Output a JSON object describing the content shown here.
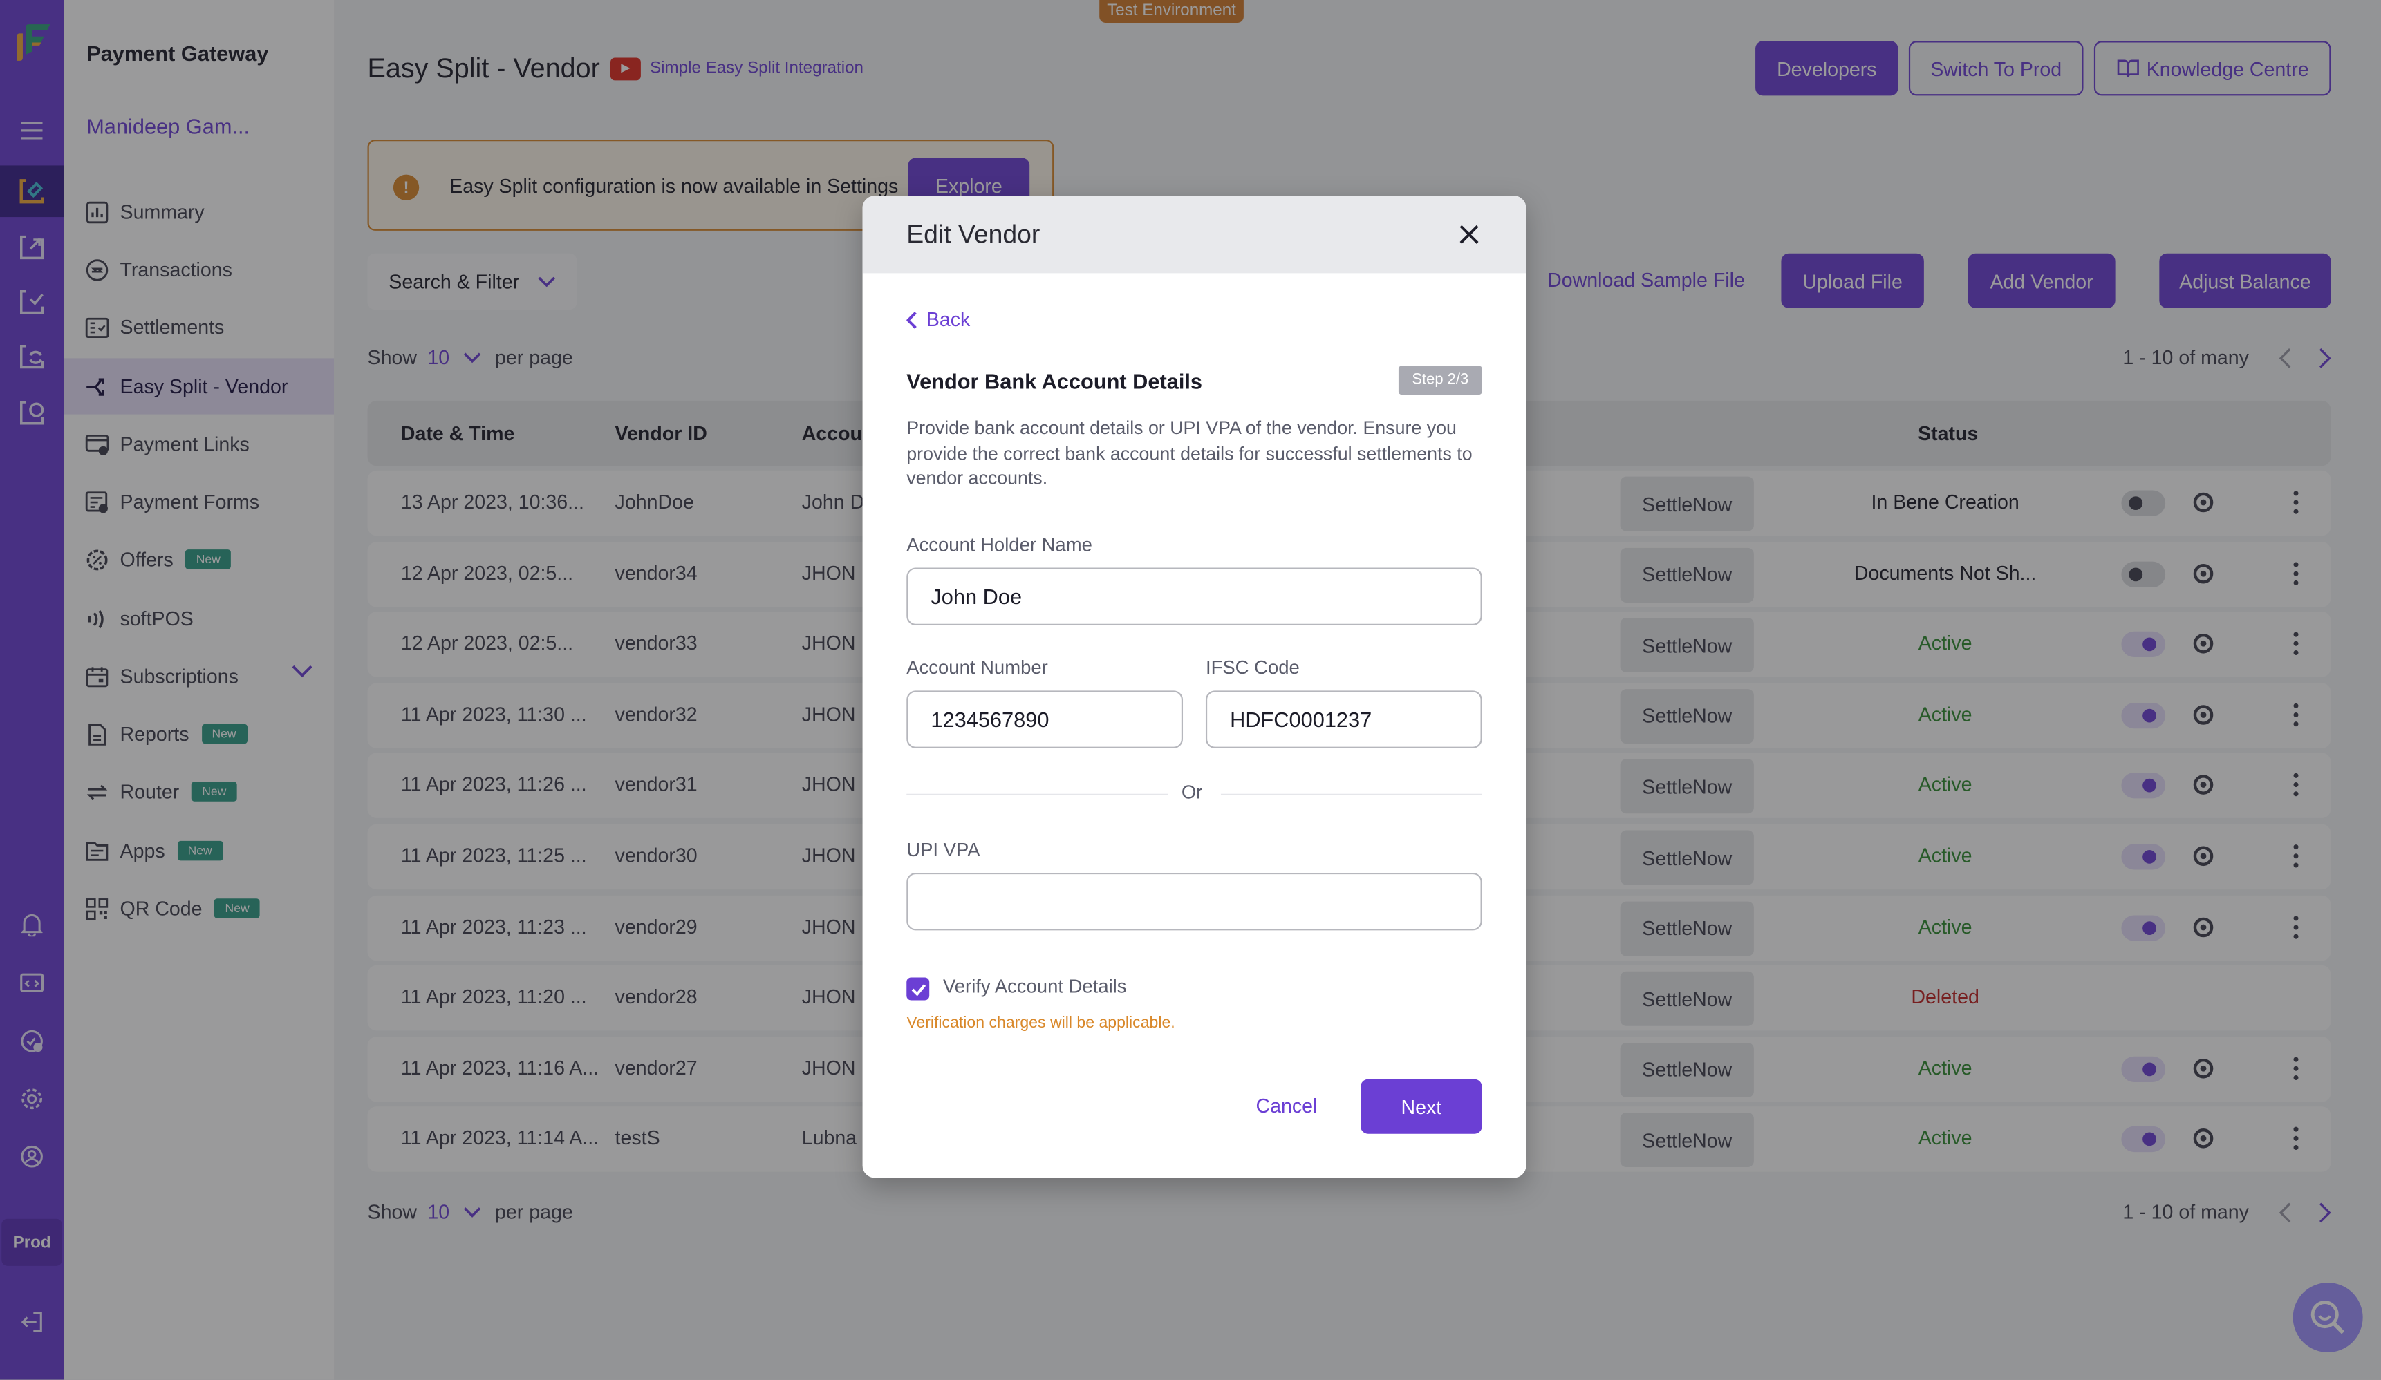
{
  "env_badge": "Test Environment",
  "rail": {
    "top_icons": [
      "payment-gateway-icon",
      "payouts-icon",
      "verification-icon",
      "subscriptions-icon",
      "secure-id-icon"
    ],
    "bottom_icons": [
      "bell-icon",
      "developer-icon",
      "clock-download-icon",
      "gear-icon",
      "user-circle-icon"
    ],
    "env_label": "Prod",
    "logout_icon": "logout-icon"
  },
  "sidenav": {
    "title": "Payment Gateway",
    "merchant": "Manideep Gam...",
    "items": [
      {
        "label": "Summary",
        "icon": "chart-icon",
        "badge": ""
      },
      {
        "label": "Transactions",
        "icon": "transactions-icon",
        "badge": ""
      },
      {
        "label": "Settlements",
        "icon": "settlements-icon",
        "badge": ""
      },
      {
        "label": "Easy Split - Vendor",
        "icon": "split-icon",
        "badge": "",
        "active": true
      },
      {
        "label": "Payment Links",
        "icon": "payment-link-icon",
        "badge": ""
      },
      {
        "label": "Payment Forms",
        "icon": "payment-form-icon",
        "badge": ""
      },
      {
        "label": "Offers",
        "icon": "offer-icon",
        "badge": "New"
      },
      {
        "label": "softPOS",
        "icon": "nfc-icon",
        "badge": ""
      },
      {
        "label": "Subscriptions",
        "icon": "calendar-icon",
        "badge": "",
        "expandable": true
      },
      {
        "label": "Reports",
        "icon": "report-icon",
        "badge": "New"
      },
      {
        "label": "Router",
        "icon": "router-icon",
        "badge": "New"
      },
      {
        "label": "Apps",
        "icon": "apps-icon",
        "badge": "New"
      },
      {
        "label": "QR Code",
        "icon": "qr-code-icon",
        "badge": "New"
      }
    ]
  },
  "header": {
    "title": "Easy Split - Vendor",
    "video_link": "Simple Easy Split Integration",
    "developers": "Developers",
    "switch_prod": "Switch To Prod",
    "knowledge": "Knowledge Centre"
  },
  "alert": {
    "text": "Easy Split configuration is now available in Settings",
    "button": "Explore"
  },
  "toolbar": {
    "search_filter": "Search & Filter",
    "download_sample": "Download Sample File",
    "upload_file": "Upload File",
    "add_vendor": "Add Vendor",
    "adjust_balance": "Adjust Balance"
  },
  "pagination": {
    "show": "Show",
    "per_page_value": "10",
    "per_page": "per page",
    "range": "1 - 10 of many"
  },
  "table": {
    "columns": [
      "Date & Time",
      "Vendor ID",
      "Accoun",
      "Status"
    ],
    "settle_label": "SettleNow",
    "rows": [
      {
        "date": "13 Apr 2023, 10:36...",
        "vendor_id": "JohnDoe",
        "account": "John D",
        "status": "In Bene Creation",
        "status_type": "neutral",
        "toggle": "off"
      },
      {
        "date": "12 Apr 2023, 02:5...",
        "vendor_id": "vendor34",
        "account": "JHON I",
        "status": "Documents Not Sh...",
        "status_type": "neutral",
        "toggle": "off"
      },
      {
        "date": "12 Apr 2023, 02:5...",
        "vendor_id": "vendor33",
        "account": "JHON I",
        "status": "Active",
        "status_type": "active",
        "toggle": "on"
      },
      {
        "date": "11 Apr 2023, 11:30 ...",
        "vendor_id": "vendor32",
        "account": "JHON I",
        "status": "Active",
        "status_type": "active",
        "toggle": "on"
      },
      {
        "date": "11 Apr 2023, 11:26 ...",
        "vendor_id": "vendor31",
        "account": "JHON I",
        "status": "Active",
        "status_type": "active",
        "toggle": "on"
      },
      {
        "date": "11 Apr 2023, 11:25 ...",
        "vendor_id": "vendor30",
        "account": "JHON I",
        "status": "Active",
        "status_type": "active",
        "toggle": "on"
      },
      {
        "date": "11 Apr 2023, 11:23 ...",
        "vendor_id": "vendor29",
        "account": "JHON I",
        "status": "Active",
        "status_type": "active",
        "toggle": "on"
      },
      {
        "date": "11 Apr 2023, 11:20 ...",
        "vendor_id": "vendor28",
        "account": "JHON I",
        "status": "Deleted",
        "status_type": "deleted",
        "toggle": "none"
      },
      {
        "date": "11 Apr 2023, 11:16 A...",
        "vendor_id": "vendor27",
        "account": "JHON I",
        "status": "Active",
        "status_type": "active",
        "toggle": "on"
      },
      {
        "date": "11 Apr 2023, 11:14 A...",
        "vendor_id": "testS",
        "account": "Lubna r",
        "status": "Active",
        "status_type": "active",
        "toggle": "on"
      }
    ]
  },
  "modal": {
    "title": "Edit Vendor",
    "back": "Back",
    "section_title": "Vendor Bank Account Details",
    "step": "Step 2/3",
    "description": "Provide bank account details or UPI VPA of the vendor. Ensure you provide the correct bank account details for successful settlements to vendor accounts.",
    "account_holder_label": "Account Holder Name",
    "account_holder_value": "John Doe",
    "account_number_label": "Account Number",
    "account_number_value": "1234567890",
    "ifsc_label": "IFSC Code",
    "ifsc_value": "HDFC0001237",
    "or": "Or",
    "upi_label": "UPI VPA",
    "upi_value": "",
    "verify_label": "Verify Account Details",
    "verify_checked": true,
    "warning": "Verification charges will be applicable.",
    "cancel": "Cancel",
    "next": "Next"
  },
  "colors": {
    "brand": "#6b3fd4",
    "active_status": "#2f8a2f",
    "deleted_status": "#c02020",
    "warning": "#d9882a",
    "new_badge": "#2f9b86"
  }
}
